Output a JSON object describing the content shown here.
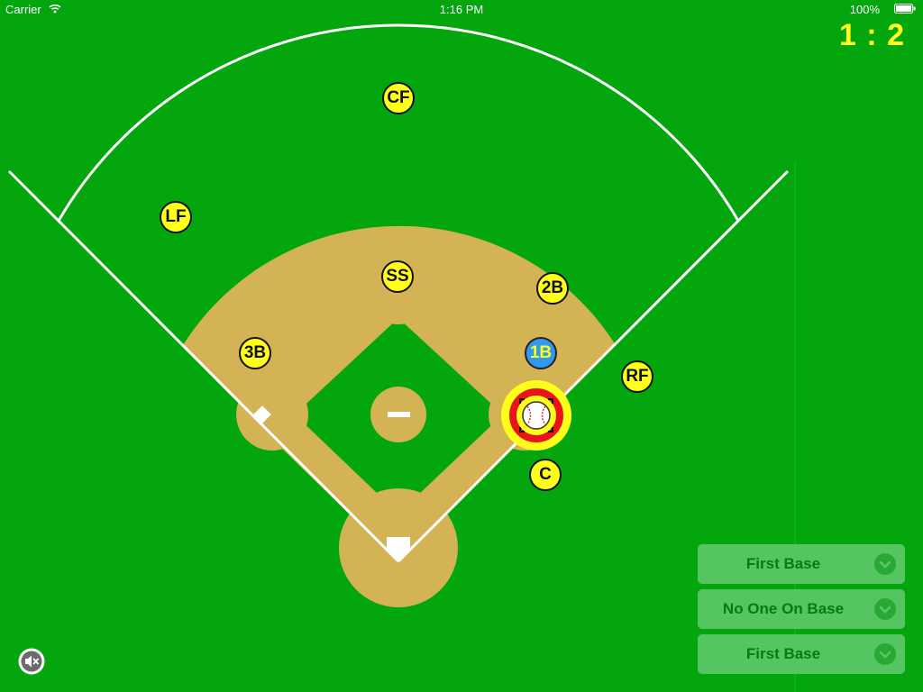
{
  "status_bar": {
    "carrier": "Carrier",
    "time": "1:16 PM",
    "battery": "100%"
  },
  "score": "1 : 2",
  "players": {
    "cf": "CF",
    "lf": "LF",
    "ss": "SS",
    "second_base": "2B",
    "first_base_runner": "1B",
    "third_base": "3B",
    "rf": "RF",
    "catcher": "C"
  },
  "selectors": [
    {
      "label": "First Base"
    },
    {
      "label": "No One On Base"
    },
    {
      "label": "First Base"
    }
  ],
  "colors": {
    "grass": "#04a60e",
    "dirt": "#d4b355",
    "player": "#ffff1a",
    "runner": "#2f9af0",
    "score": "#ffff1a"
  },
  "icons": [
    "wifi-icon",
    "battery-icon",
    "baseball-icon",
    "chevron-down-icon",
    "mute-icon"
  ]
}
